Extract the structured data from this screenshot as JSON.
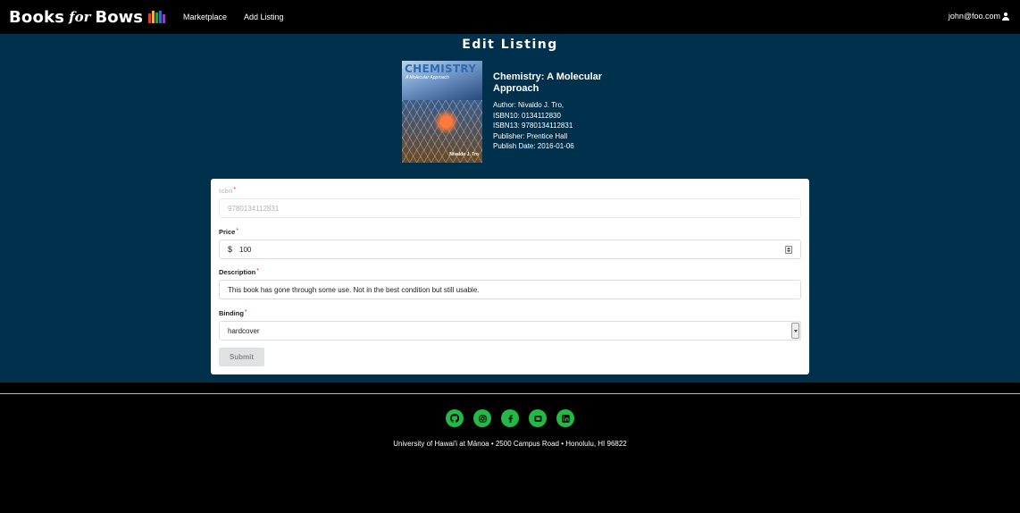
{
  "navbar": {
    "brand_part1": "Books",
    "brand_part2": "for",
    "brand_part3": "Bows",
    "links": [
      "Marketplace",
      "Add Listing"
    ],
    "user": "john@foo.com",
    "logo_colors": [
      "#e03e2f",
      "#f2b132",
      "#2e9a47",
      "#2c6fce",
      "#8e44ad"
    ]
  },
  "page": {
    "title": "Edit Listing"
  },
  "book": {
    "cover_title": "CHEMISTRY",
    "cover_subtitle": "A Molecular Approach",
    "cover_author": "Nivaldo J. Tro",
    "title": "Chemistry: A Molecular Approach",
    "author": "Author: Nivaldo J. Tro,",
    "isbn10": "ISBN10: 0134112830",
    "isbn13": "ISBN13: 9780134112831",
    "publisher": "Publisher: Prentice Hall",
    "publish_date": "Publish Date: 2016-01-06"
  },
  "form": {
    "isbn_label": "Isbn",
    "isbn_value": "9780134112831",
    "price_label": "Price",
    "price_prefix": "$",
    "price_value": "100",
    "description_label": "Description",
    "description_value": "This book has gone through some use. Not in the best condition but still usable.",
    "binding_label": "Binding",
    "binding_value": "hardcover",
    "required_mark": "*",
    "submit_label": "Submit"
  },
  "footer": {
    "socials": [
      "github-icon",
      "instagram-icon",
      "facebook-icon",
      "devpost-icon",
      "linkedin-icon"
    ],
    "address": "University of Hawai'i at Mānoa • 2500 Campus Road • Honolulu, HI 96822",
    "accent_color": "#21ba45"
  }
}
